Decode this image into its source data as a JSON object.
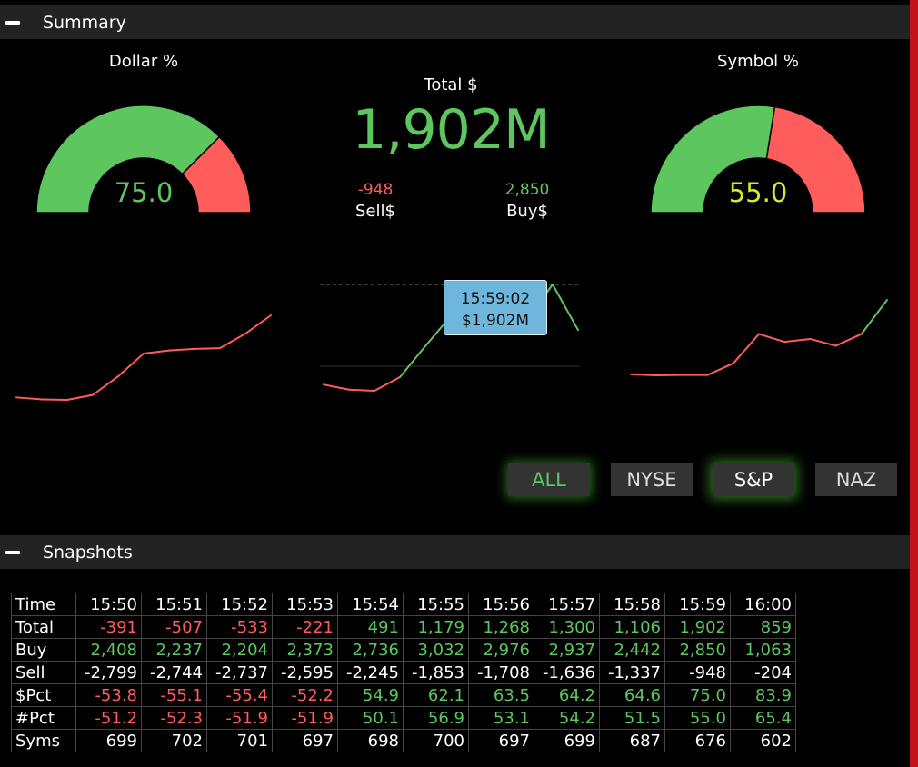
{
  "summary": {
    "header": "Summary",
    "dollar_pct": {
      "label": "Dollar %",
      "value": "75.0",
      "fraction": 0.75
    },
    "symbol_pct": {
      "label": "Symbol %",
      "value": "55.0",
      "fraction": 0.55
    },
    "total": {
      "label": "Total $",
      "value": "1,902M"
    },
    "sell": {
      "value": "-948",
      "label": "Sell$"
    },
    "buy": {
      "value": "2,850",
      "label": "Buy$"
    },
    "tooltip": {
      "time": "15:59:02",
      "value": "$1,902M"
    },
    "buttons": [
      "ALL",
      "NYSE",
      "S&P",
      "NAZ"
    ],
    "colors": {
      "green": "#5ec65e",
      "red": "#ff5c5c",
      "yellow": "#d4ec2a",
      "tooltip": "#6fb6dd"
    }
  },
  "snapshots": {
    "header": "Snapshots",
    "times": [
      "15:50",
      "15:51",
      "15:52",
      "15:53",
      "15:54",
      "15:55",
      "15:56",
      "15:57",
      "15:58",
      "15:59",
      "16:00"
    ],
    "rows": [
      {
        "label": "Total",
        "values": [
          "-391",
          "-507",
          "-533",
          "-221",
          "491",
          "1,179",
          "1,268",
          "1,300",
          "1,106",
          "1,902",
          "859"
        ],
        "color": "sign"
      },
      {
        "label": "Buy",
        "values": [
          "2,408",
          "2,237",
          "2,204",
          "2,373",
          "2,736",
          "3,032",
          "2,976",
          "2,937",
          "2,442",
          "2,850",
          "1,063"
        ],
        "color": "pos"
      },
      {
        "label": "Sell",
        "values": [
          "-2,799",
          "-2,744",
          "-2,737",
          "-2,595",
          "-2,245",
          "-1,853",
          "-1,708",
          "-1,636",
          "-1,337",
          "-948",
          "-204"
        ],
        "color": "neu"
      },
      {
        "label": "$Pct",
        "values": [
          "-53.8",
          "-55.1",
          "-55.4",
          "-52.2",
          "54.9",
          "62.1",
          "63.5",
          "64.2",
          "64.6",
          "75.0",
          "83.9"
        ],
        "color": "sign"
      },
      {
        "label": "#Pct",
        "values": [
          "-51.2",
          "-52.3",
          "-51.9",
          "-51.9",
          "50.1",
          "56.9",
          "53.1",
          "54.2",
          "51.5",
          "55.0",
          "65.4"
        ],
        "color": "sign"
      },
      {
        "label": "Syms",
        "values": [
          "699",
          "702",
          "701",
          "697",
          "698",
          "700",
          "697",
          "699",
          "687",
          "676",
          "602"
        ],
        "color": "neu"
      }
    ]
  },
  "chart_data": [
    {
      "type": "line",
      "series": [
        {
          "values": [
            -53.8,
            -55.1,
            -55.4,
            -52.2,
            -40,
            -25,
            -23,
            -22,
            -21.5,
            -12,
            0
          ]
        }
      ]
    },
    {
      "type": "line",
      "series": [
        {
          "values": [
            -391,
            -507,
            -533,
            -221,
            491,
            1179,
            1268,
            1300,
            1106,
            1902,
            859
          ]
        }
      ]
    },
    {
      "type": "line",
      "series": [
        {
          "values": [
            -51.2,
            -52.3,
            -51.9,
            -51.9,
            -40,
            -10,
            -18,
            -15,
            -22,
            -10,
            25
          ]
        }
      ]
    }
  ]
}
